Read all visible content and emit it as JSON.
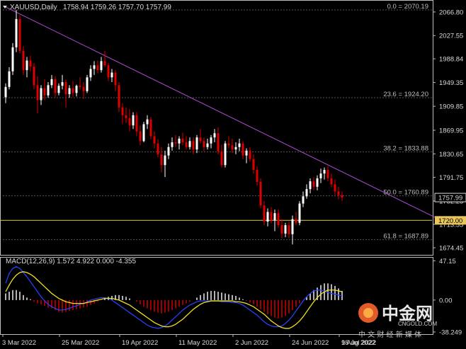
{
  "header": {
    "symbol": "XAUUSD,Daily",
    "ohlc": "1758.94 1759.26 1757.70 1757.99"
  },
  "macd_header": {
    "label": "MACD(12,26,9) 1.572 4.922 0.000 -4.355"
  },
  "colors": {
    "background": "#000000",
    "bull": "#ffffff",
    "bear": "#e00000",
    "trendline": "#b24bd8",
    "support": "#e8c65a",
    "macd_line": "#2a3ef5",
    "signal_line": "#f0e020",
    "hist_pos": "#ffffff",
    "hist_neg": "#e00000",
    "grid": "#555555"
  },
  "watermark": {
    "brand_cn": "中金网",
    "domain": "CNGOLD.COM",
    "tagline": "中 文 财 经 新 媒 体"
  },
  "chart_data": [
    {
      "type": "candlestick",
      "title": "XAUUSD,Daily",
      "ylim": [
        1665,
        2082
      ],
      "price_ticks": [
        "2066.80",
        "2027.55",
        "1988.84",
        "1949.35",
        "1909.85",
        "1869.95",
        "1830.65",
        "1791.75",
        "1752.25",
        "1713.55",
        "1674.45"
      ],
      "current_price": "1757.99",
      "support_label": "1720.00",
      "x_labels": [
        "3 Mar 2022",
        "25 Mar 2022",
        "19 Apr 2022",
        "11 May 2022",
        "2 Jun 2022",
        "24 Jun 2022",
        "18 Jul 2022",
        "9 Aug 2022"
      ],
      "fibonacci": [
        {
          "label": "0.0 = 2070.19",
          "value": 2070.19
        },
        {
          "label": "23.6 = 1924.20",
          "value": 1924.2
        },
        {
          "label": "38.2 = 1833.88",
          "value": 1833.88
        },
        {
          "label": "50.0 = 1760.89",
          "value": 1760.89
        },
        {
          "label": "61.8 = 1687.89",
          "value": 1687.89
        }
      ],
      "support_line": 1720.0,
      "trendline": {
        "from": [
          0,
          2075
        ],
        "to": [
          123,
          1720
        ]
      },
      "candles": [
        [
          1925,
          1948,
          1915,
          1942
        ],
        [
          1942,
          1975,
          1938,
          1968
        ],
        [
          1968,
          2015,
          1962,
          2008
        ],
        [
          2008,
          2070,
          2000,
          2055
        ],
        [
          2055,
          2062,
          1998,
          2002
        ],
        [
          2002,
          2010,
          1962,
          1970
        ],
        [
          1970,
          1992,
          1958,
          1986
        ],
        [
          1986,
          1994,
          1968,
          1976
        ],
        [
          1976,
          1982,
          1938,
          1945
        ],
        [
          1945,
          1960,
          1898,
          1920
        ],
        [
          1920,
          1945,
          1912,
          1940
        ],
        [
          1940,
          1955,
          1920,
          1928
        ],
        [
          1928,
          1950,
          1924,
          1945
        ],
        [
          1945,
          1962,
          1940,
          1955
        ],
        [
          1955,
          1960,
          1925,
          1932
        ],
        [
          1932,
          1948,
          1928,
          1944
        ],
        [
          1944,
          1962,
          1938,
          1950
        ],
        [
          1950,
          1954,
          1908,
          1930
        ],
        [
          1930,
          1945,
          1924,
          1940
        ],
        [
          1940,
          1952,
          1925,
          1932
        ],
        [
          1932,
          1946,
          1926,
          1944
        ],
        [
          1944,
          1958,
          1938,
          1942
        ],
        [
          1942,
          1950,
          1922,
          1935
        ],
        [
          1935,
          1962,
          1932,
          1958
        ],
        [
          1958,
          1978,
          1952,
          1972
        ],
        [
          1972,
          1985,
          1962,
          1978
        ],
        [
          1978,
          1986,
          1965,
          1970
        ],
        [
          1970,
          1992,
          1966,
          1985
        ],
        [
          1985,
          2002,
          1975,
          1978
        ],
        [
          1978,
          1982,
          1952,
          1958
        ],
        [
          1958,
          1972,
          1950,
          1966
        ],
        [
          1966,
          1970,
          1935,
          1945
        ],
        [
          1945,
          1950,
          1900,
          1908
        ],
        [
          1908,
          1915,
          1880,
          1895
        ],
        [
          1895,
          1908,
          1882,
          1890
        ],
        [
          1890,
          1905,
          1868,
          1878
        ],
        [
          1878,
          1900,
          1872,
          1895
        ],
        [
          1895,
          1900,
          1860,
          1868
        ],
        [
          1868,
          1878,
          1845,
          1852
        ],
        [
          1852,
          1884,
          1850,
          1880
        ],
        [
          1880,
          1895,
          1872,
          1888
        ],
        [
          1888,
          1892,
          1855,
          1860
        ],
        [
          1860,
          1868,
          1840,
          1848
        ],
        [
          1848,
          1855,
          1825,
          1830
        ],
        [
          1830,
          1842,
          1800,
          1812
        ],
        [
          1812,
          1836,
          1792,
          1828
        ],
        [
          1828,
          1848,
          1822,
          1842
        ],
        [
          1842,
          1858,
          1836,
          1850
        ],
        [
          1850,
          1862,
          1842,
          1848
        ],
        [
          1848,
          1860,
          1838,
          1856
        ],
        [
          1856,
          1866,
          1845,
          1850
        ],
        [
          1850,
          1860,
          1838,
          1842
        ],
        [
          1842,
          1858,
          1838,
          1852
        ],
        [
          1852,
          1858,
          1830,
          1838
        ],
        [
          1838,
          1862,
          1832,
          1858
        ],
        [
          1858,
          1872,
          1848,
          1852
        ],
        [
          1852,
          1858,
          1835,
          1842
        ],
        [
          1842,
          1856,
          1838,
          1848
        ],
        [
          1848,
          1862,
          1840,
          1858
        ],
        [
          1858,
          1872,
          1850,
          1865
        ],
        [
          1865,
          1875,
          1830,
          1835
        ],
        [
          1835,
          1846,
          1808,
          1812
        ],
        [
          1812,
          1852,
          1808,
          1848
        ],
        [
          1848,
          1860,
          1840,
          1845
        ],
        [
          1845,
          1856,
          1832,
          1838
        ],
        [
          1838,
          1850,
          1830,
          1842
        ],
        [
          1842,
          1856,
          1835,
          1848
        ],
        [
          1848,
          1852,
          1822,
          1828
        ],
        [
          1828,
          1840,
          1815,
          1836
        ],
        [
          1836,
          1842,
          1818,
          1822
        ],
        [
          1822,
          1830,
          1798,
          1804
        ],
        [
          1804,
          1810,
          1778,
          1784
        ],
        [
          1784,
          1790,
          1740,
          1745
        ],
        [
          1745,
          1752,
          1712,
          1718
        ],
        [
          1718,
          1740,
          1710,
          1734
        ],
        [
          1734,
          1742,
          1715,
          1720
        ],
        [
          1720,
          1738,
          1702,
          1732
        ],
        [
          1732,
          1738,
          1708,
          1712
        ],
        [
          1712,
          1722,
          1690,
          1698
        ],
        [
          1698,
          1716,
          1692,
          1712
        ],
        [
          1712,
          1718,
          1690,
          1697
        ],
        [
          1697,
          1728,
          1680,
          1722
        ],
        [
          1722,
          1734,
          1712,
          1716
        ],
        [
          1716,
          1752,
          1712,
          1748
        ],
        [
          1748,
          1768,
          1742,
          1760
        ],
        [
          1760,
          1780,
          1756,
          1772
        ],
        [
          1772,
          1790,
          1765,
          1785
        ],
        [
          1785,
          1792,
          1770,
          1776
        ],
        [
          1776,
          1795,
          1770,
          1790
        ],
        [
          1790,
          1806,
          1782,
          1798
        ],
        [
          1798,
          1808,
          1788,
          1804
        ],
        [
          1804,
          1810,
          1785,
          1790
        ],
        [
          1790,
          1798,
          1775,
          1780
        ],
        [
          1780,
          1788,
          1762,
          1768
        ],
        [
          1768,
          1776,
          1755,
          1762
        ],
        [
          1762,
          1768,
          1752,
          1758
        ]
      ]
    },
    {
      "type": "line",
      "title": "MACD(12,26,9) 1.572 4.922 0.000 -4.355",
      "ylim": [
        -40,
        50
      ],
      "y_ticks": [
        "47.15",
        "0.00",
        "-38.249"
      ],
      "histogram": [
        8,
        10,
        12,
        12,
        10,
        6,
        3,
        1,
        -2,
        -4,
        -5,
        -7,
        -9,
        -10,
        -12,
        -14,
        -15,
        -14,
        -13,
        -12,
        -11,
        -10,
        -9,
        -8,
        -6,
        -4,
        -2,
        0,
        2,
        4,
        5,
        6,
        6,
        5,
        4,
        2,
        0,
        -2,
        -5,
        -8,
        -10,
        -12,
        -14,
        -15,
        -16,
        -15,
        -14,
        -12,
        -10,
        -8,
        -6,
        -4,
        -2,
        0,
        3,
        6,
        8,
        10,
        11,
        11,
        10,
        9,
        8,
        7,
        6,
        5,
        3,
        1,
        -1,
        -3,
        -5,
        -8,
        -11,
        -14,
        -17,
        -19,
        -21,
        -22,
        -21,
        -19,
        -16,
        -12,
        -8,
        -4,
        0,
        4,
        8,
        12,
        15,
        18,
        20,
        20,
        19,
        17,
        14,
        11,
        8,
        5,
        2,
        -2
      ],
      "macd_line": [
        20,
        32,
        38,
        40,
        38,
        33,
        28,
        22,
        16,
        10,
        4,
        -1,
        -5,
        -8,
        -10,
        -12,
        -12,
        -11,
        -10,
        -8,
        -7,
        -5,
        -4,
        -2,
        0,
        1,
        2,
        3,
        3,
        2,
        0,
        -3,
        -6,
        -9,
        -12,
        -15,
        -18,
        -21,
        -24,
        -27,
        -30,
        -32,
        -33,
        -34,
        -33,
        -31,
        -28,
        -24,
        -20,
        -16,
        -12,
        -9,
        -6,
        -4,
        -2,
        -1,
        -1,
        -1,
        -1,
        -1,
        -1,
        -2,
        -2,
        -2,
        -3,
        -3,
        -4,
        -6,
        -9,
        -12,
        -15,
        -18,
        -22,
        -26,
        -29,
        -31,
        -32,
        -32,
        -31,
        -28,
        -24,
        -19,
        -13,
        -7,
        -1,
        4,
        8,
        11,
        12,
        12,
        11,
        9,
        8,
        7,
        6,
        5,
        5,
        6,
        6,
        5
      ],
      "signal_line": [
        10,
        18,
        25,
        30,
        33,
        34,
        33,
        31,
        28,
        24,
        20,
        16,
        12,
        8,
        5,
        2,
        0,
        -2,
        -3,
        -4,
        -4,
        -4,
        -4,
        -3,
        -2,
        -1,
        0,
        1,
        2,
        2,
        2,
        1,
        0,
        -2,
        -4,
        -6,
        -9,
        -12,
        -15,
        -18,
        -21,
        -24,
        -27,
        -29,
        -31,
        -32,
        -32,
        -31,
        -29,
        -26,
        -23,
        -19,
        -15,
        -11,
        -8,
        -5,
        -3,
        -2,
        -1,
        -1,
        -1,
        -1,
        -1,
        -1,
        -1,
        -2,
        -2,
        -3,
        -4,
        -6,
        -8,
        -11,
        -14,
        -17,
        -21,
        -25,
        -28,
        -31,
        -33,
        -34,
        -34,
        -32,
        -29,
        -25,
        -20,
        -14,
        -8,
        -2,
        3,
        7,
        10,
        12,
        12,
        12,
        11,
        10,
        9,
        8,
        7,
        6
      ]
    }
  ]
}
